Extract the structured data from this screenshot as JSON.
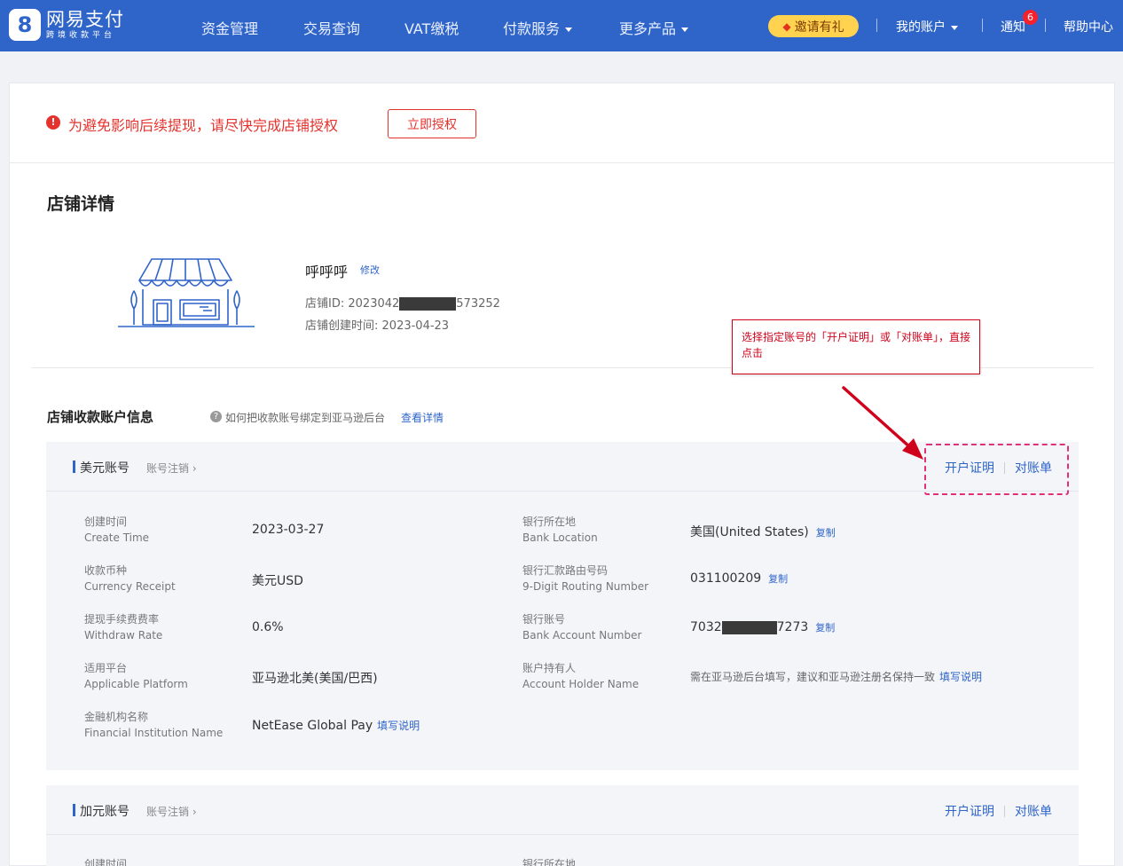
{
  "header": {
    "logo_mark": "8",
    "logo_name": "网易支付",
    "logo_sub": "跨境收款平台",
    "nav": [
      "资金管理",
      "交易查询",
      "VAT缴税",
      "付款服务",
      "更多产品"
    ],
    "invite": "邀请有礼",
    "my_account": "我的账户",
    "notice": "通知",
    "notice_count": "6",
    "help": "帮助中心"
  },
  "alert": {
    "icon": "!",
    "text": "为避免影响后续提现，请尽快完成店铺授权",
    "button": "立即授权"
  },
  "shop": {
    "section_title": "店铺详情",
    "name": "呼呼呼",
    "edit": "修改",
    "id_label": "店铺ID:",
    "id_prefix": "2023042",
    "id_suffix": "573252",
    "created_label": "店铺创建时间:",
    "created": "2023-04-23"
  },
  "callout": {
    "text": "选择指定账号的「开户证明」或「对账单」，直接点击"
  },
  "accounts_section": {
    "title": "店铺收款账户信息",
    "help_icon": "?",
    "help_text": "如何把收款账号绑定到亚马逊后台",
    "help_link": "查看详情"
  },
  "usd_account": {
    "name": "美元账号",
    "cancel": "账号注销 ›",
    "proof": "开户证明",
    "statement": "对账单",
    "fields_left": [
      {
        "label_cn": "创建时间",
        "label_en": "Create Time",
        "value": "2023-03-27"
      },
      {
        "label_cn": "收款币种",
        "label_en": "Currency Receipt",
        "value": "美元USD"
      },
      {
        "label_cn": "提现手续费费率",
        "label_en": "Withdraw Rate",
        "value": "0.6%"
      },
      {
        "label_cn": "适用平台",
        "label_en": "Applicable Platform",
        "value": "亚马逊北美(美国/巴西)"
      },
      {
        "label_cn": "金融机构名称",
        "label_en": "Financial Institution Name",
        "value": "NetEase Global Pay",
        "link": "填写说明"
      }
    ],
    "fields_right": [
      {
        "label_cn": "银行所在地",
        "label_en": "Bank Location",
        "value": "美国(United States)",
        "copy": "复制"
      },
      {
        "label_cn": "银行汇款路由号码",
        "label_en": "9-Digit Routing Number",
        "value": "031100209",
        "copy": "复制"
      },
      {
        "label_cn": "银行账号",
        "label_en": "Bank Account Number",
        "value_prefix": "7032",
        "value_suffix": "7273",
        "copy": "复制"
      },
      {
        "label_cn": "账户持有人",
        "label_en": "Account Holder Name",
        "value": "需在亚马逊后台填写，建议和亚马逊注册名保持一致",
        "link": "填写说明"
      }
    ]
  },
  "cad_account": {
    "name": "加元账号",
    "cancel": "账号注销 ›",
    "proof": "开户证明",
    "statement": "对账单",
    "label_left": "创建时间",
    "label_right": "银行所在地"
  },
  "colors": {
    "brand": "#2f64c8",
    "alert": "#e5322d",
    "callout": "#d0021b",
    "highlight_dash": "#e0307a"
  }
}
